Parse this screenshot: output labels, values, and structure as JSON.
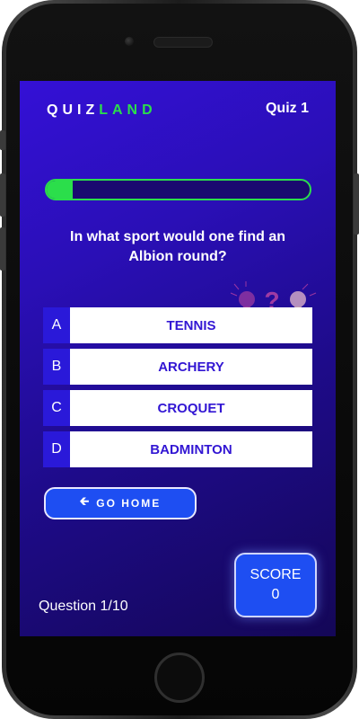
{
  "header": {
    "logo_part1": "QUIZ",
    "logo_part2": "LAND",
    "quiz_label": "Quiz 1"
  },
  "progress": {
    "fraction": 0.1
  },
  "question": {
    "text": "In what sport would one find an Albion round?"
  },
  "answers": [
    {
      "letter": "A",
      "text": "TENNIS"
    },
    {
      "letter": "B",
      "text": "ARCHERY"
    },
    {
      "letter": "C",
      "text": "CROQUET"
    },
    {
      "letter": "D",
      "text": "BADMINTON"
    }
  ],
  "go_home": {
    "icon": "arrow-left-icon",
    "label": "GO HOME"
  },
  "footer": {
    "question_counter": "Question 1/10",
    "score_label": "SCORE",
    "score_value": "0"
  },
  "colors": {
    "accent_green": "#2bde4b",
    "button_blue": "#1e4ef2",
    "answer_text": "#3216d3",
    "letter_bg": "#2a19d9"
  }
}
